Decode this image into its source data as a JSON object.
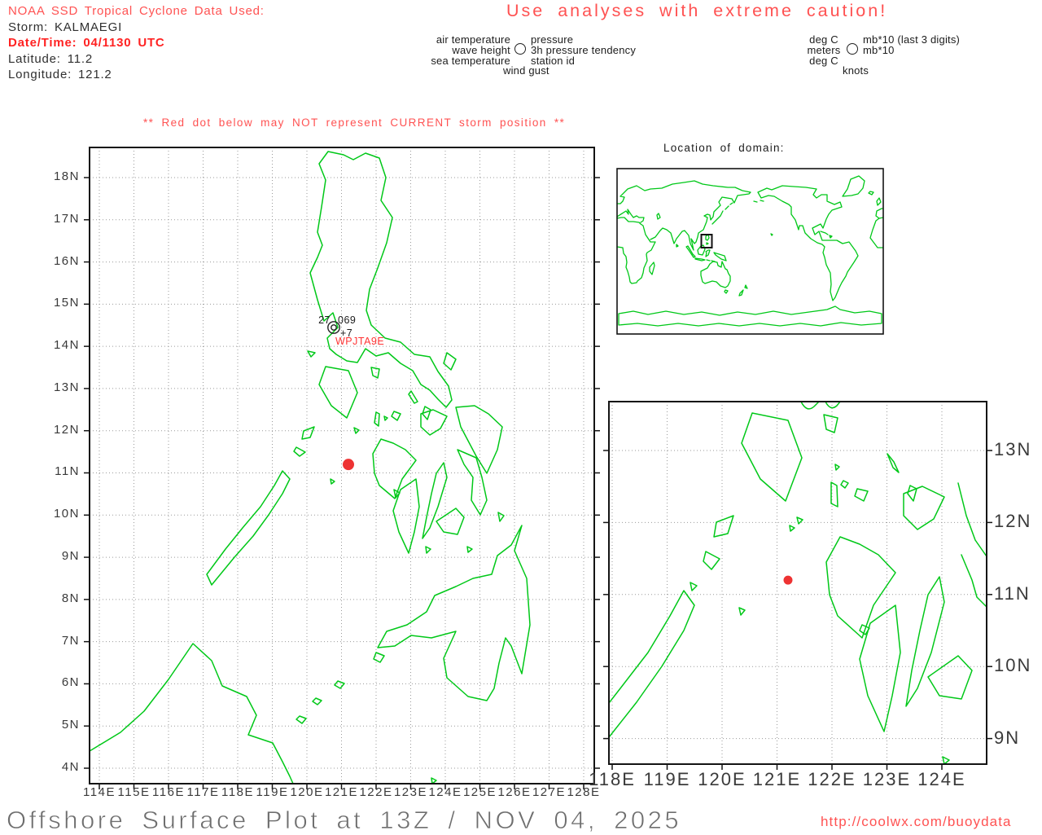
{
  "header": {
    "noaa_line": "NOAA SSD Tropical Cyclone Data Used:",
    "storm_line": "Storm: KALMAEGI",
    "datetime_line": "Date/Time: 04/1130 UTC",
    "latitude_line": "Latitude: 11.2",
    "longitude_line": "Longitude: 121.2",
    "caution": "Use analyses with extreme caution!"
  },
  "station_legend": {
    "rows": [
      {
        "left": "air temperature",
        "right": "pressure"
      },
      {
        "left": "wave height",
        "right": "3h pressure tendency"
      },
      {
        "left": "sea temperature",
        "right": "station id"
      },
      {
        "left": "",
        "right": "wind gust"
      }
    ]
  },
  "units_legend": {
    "rows": [
      {
        "left": "deg C",
        "right": "mb*10 (last 3 digits)"
      },
      {
        "left": "meters",
        "right": "mb*10"
      },
      {
        "left": "deg C",
        "right": ""
      },
      {
        "left": "",
        "right": "knots"
      }
    ]
  },
  "warning": "** Red dot below may NOT represent CURRENT storm position **",
  "main_map": {
    "x_tick_labels": [
      "114E",
      "115E",
      "116E",
      "117E",
      "118E",
      "119E",
      "120E",
      "121E",
      "122E",
      "123E",
      "124E",
      "125E",
      "126E",
      "127E",
      "128E"
    ],
    "y_tick_labels": [
      "18N",
      "17N",
      "16N",
      "15N",
      "14N",
      "13N",
      "12N",
      "11N",
      "10N",
      "9N",
      "8N",
      "7N",
      "6N",
      "5N",
      "4N"
    ],
    "station": {
      "air_temp": "27",
      "pressure": "069",
      "tendency": "+7",
      "id": "WPJTA9E"
    },
    "storm_dot": {
      "lat": 11.2,
      "lon": 121.2
    }
  },
  "inset": {
    "label": "Location of domain:"
  },
  "zoom_map": {
    "x_tick_labels": [
      "118E",
      "119E",
      "120E",
      "121E",
      "122E",
      "123E",
      "124E"
    ],
    "y_tick_labels": [
      "13N",
      "12N",
      "11N",
      "10N",
      "9N"
    ],
    "storm_dot": {
      "lat": 11.2,
      "lon": 121.2
    }
  },
  "footer": {
    "title": "Offshore Surface Plot at 13Z / NOV 04, 2025",
    "url": "http://coolwx.com/buoydata"
  },
  "colors": {
    "coastline": "#00c818",
    "storm_dot": "#ee3333",
    "salmon_text": "#ff5252",
    "alert_red": "#ff2222",
    "grid": "#9a9a9a",
    "title_gray": "#6e6e6e"
  }
}
